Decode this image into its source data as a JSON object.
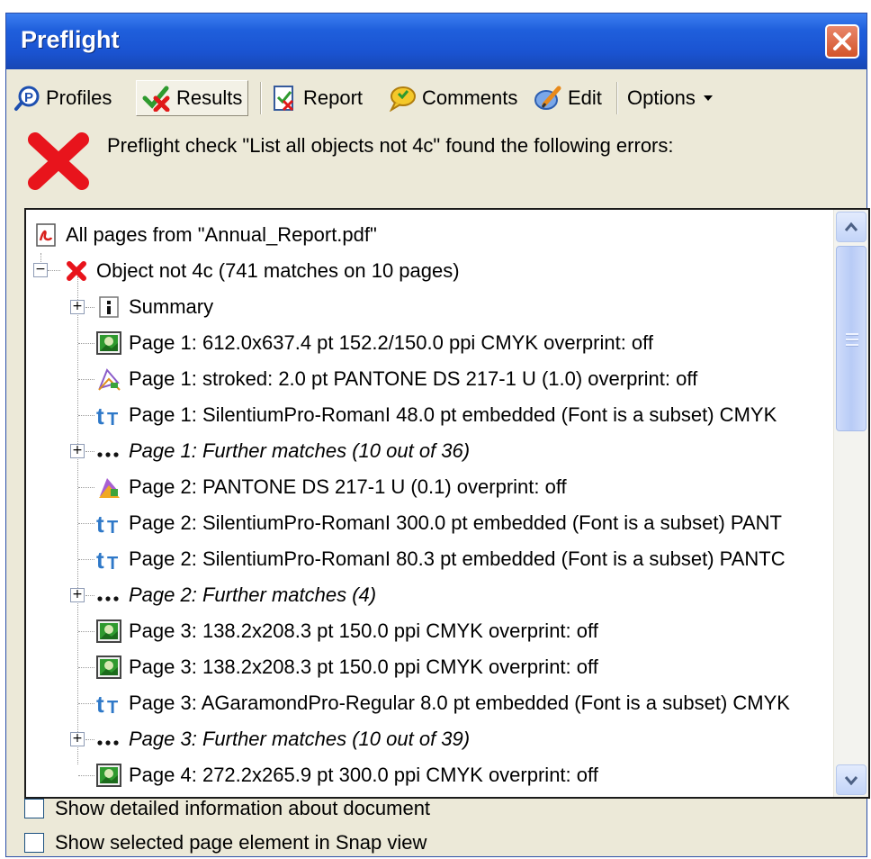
{
  "window": {
    "title": "Preflight"
  },
  "toolbar": {
    "items": [
      {
        "label": "Profiles",
        "icon": "profiles-icon"
      },
      {
        "label": "Results",
        "icon": "results-icon",
        "active": true
      },
      {
        "label": "Report",
        "icon": "report-icon"
      },
      {
        "label": "Comments",
        "icon": "comments-icon"
      },
      {
        "label": "Edit",
        "icon": "edit-icon"
      },
      {
        "label": "Options",
        "icon": "dropdown-arrow-icon"
      }
    ]
  },
  "message": {
    "text": "Preflight check \"List all objects not 4c\" found the following errors:"
  },
  "tree": {
    "root": "All pages from \"Annual_Report.pdf\"",
    "group": "Object not 4c (741 matches on 10 pages)",
    "items": [
      {
        "label": "Summary",
        "icon": "info-icon",
        "expandable": true,
        "italic": false
      },
      {
        "label": "Page 1: 612.0x637.4 pt 152.2/150.0 ppi CMYK overprint: off",
        "icon": "image-icon",
        "expandable": false,
        "italic": false
      },
      {
        "label": "Page 1: stroked: 2.0 pt PANTONE DS 217-1 U (1.0) overprint: off",
        "icon": "vector-stroke-icon",
        "expandable": false,
        "italic": false
      },
      {
        "label": "Page 1: SilentiumPro-RomanI 48.0 pt  embedded (Font is a subset) CMYK",
        "icon": "text-icon",
        "expandable": false,
        "italic": false
      },
      {
        "label": "Page 1: Further matches (10 out of 36)",
        "icon": "ellipsis-icon",
        "expandable": true,
        "italic": true
      },
      {
        "label": "Page 2: PANTONE DS 217-1 U (0.1) overprint: off",
        "icon": "vector-fill-icon",
        "expandable": false,
        "italic": false
      },
      {
        "label": "Page 2: SilentiumPro-RomanI 300.0 pt  embedded (Font is a subset) PANT",
        "icon": "text-icon",
        "expandable": false,
        "italic": false
      },
      {
        "label": "Page 2: SilentiumPro-RomanI 80.3 pt  embedded (Font is a subset) PANTC",
        "icon": "text-icon",
        "expandable": false,
        "italic": false
      },
      {
        "label": "Page 2: Further matches (4)",
        "icon": "ellipsis-icon",
        "expandable": true,
        "italic": true
      },
      {
        "label": "Page 3: 138.2x208.3 pt 150.0 ppi CMYK overprint: off",
        "icon": "image-icon",
        "expandable": false,
        "italic": false
      },
      {
        "label": "Page 3: 138.2x208.3 pt 150.0 ppi CMYK overprint: off",
        "icon": "image-icon",
        "expandable": false,
        "italic": false
      },
      {
        "label": "Page 3: AGaramondPro-Regular 8.0 pt  embedded (Font is a subset) CMYK",
        "icon": "text-icon",
        "expandable": false,
        "italic": false
      },
      {
        "label": "Page 3: Further matches (10 out of 39)",
        "icon": "ellipsis-icon",
        "expandable": true,
        "italic": true
      },
      {
        "label": "Page 4: 272.2x265.9 pt 300.0 ppi CMYK overprint: off",
        "icon": "image-icon",
        "expandable": false,
        "italic": false
      }
    ]
  },
  "options": [
    {
      "label": "Show detailed information about document",
      "checked": false
    },
    {
      "label": "Show selected page element in Snap view",
      "checked": false
    }
  ],
  "colors": {
    "titlebar": "#1f5fdc",
    "error": "#e8141c",
    "dialog": "#ece9d8"
  }
}
